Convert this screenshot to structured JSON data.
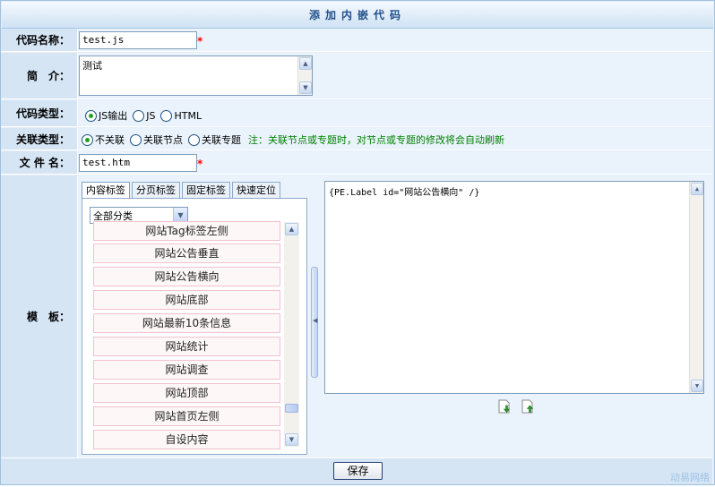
{
  "title": "添加内嵌代码",
  "fields": {
    "code_name": {
      "label": "代码名称：",
      "value": "test.js"
    },
    "intro": {
      "label": "简　介：",
      "value": "测试"
    },
    "code_type": {
      "label": "代码类型：",
      "options": [
        "JS输出",
        "JS",
        "HTML"
      ],
      "selected": "JS输出"
    },
    "link_type": {
      "label": "关联类型：",
      "options": [
        "不关联",
        "关联节点",
        "关联专题"
      ],
      "selected": "不关联",
      "note": "注：关联节点或专题时，对节点或专题的修改将会自动刷新"
    },
    "file_name": {
      "label": "文 件 名：",
      "value": "test.htm"
    },
    "template": {
      "label": "模　板："
    }
  },
  "required_mark": "*",
  "tabs": [
    "内容标签",
    "分页标签",
    "固定标签",
    "快速定位"
  ],
  "active_tab": "内容标签",
  "category_select": {
    "value": "全部分类"
  },
  "label_list": [
    "网站Tag标签左侧",
    "网站公告垂直",
    "网站公告横向",
    "网站底部",
    "网站最新10条信息",
    "网站统计",
    "网站调查",
    "网站顶部",
    "网站首页左侧",
    "自设内容"
  ],
  "template_content": "{PE.Label id=\"网站公告横向\" /}",
  "icons": {
    "move_down": "arrow-down-icon",
    "move_up": "arrow-up-icon"
  },
  "save_label": "保存",
  "brand_text": "动易网络",
  "colors": {
    "accent": "#1f4f8c",
    "required": "#ff0000",
    "note": "#008000"
  }
}
